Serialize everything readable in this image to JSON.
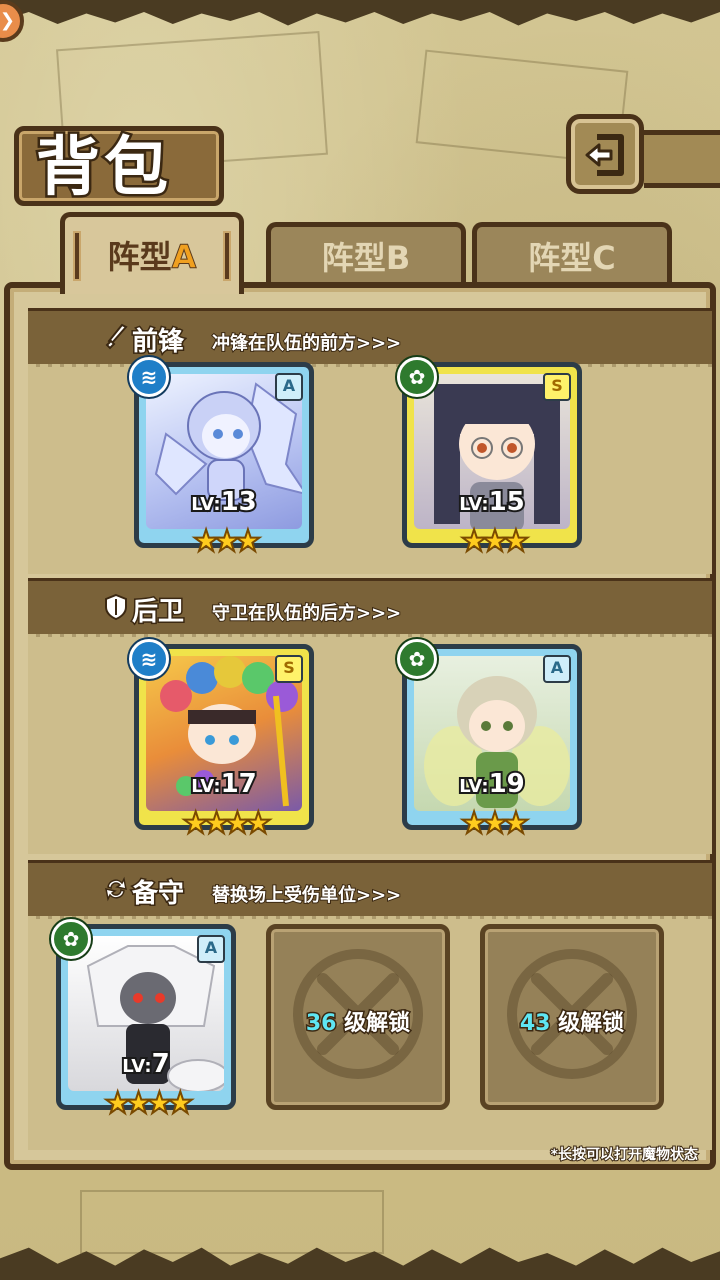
{
  "header": {
    "title": "背包"
  },
  "tabs": [
    {
      "label": "阵型",
      "suffix": "A",
      "active": true
    },
    {
      "label": "阵型",
      "suffix": "B",
      "active": false
    },
    {
      "label": "阵型",
      "suffix": "C",
      "active": false
    }
  ],
  "sections": {
    "front": {
      "title": "前锋",
      "desc": "冲锋在队伍的前方>>>"
    },
    "back": {
      "title": "后卫",
      "desc": "守卫在队伍的后方>>>"
    },
    "reserve": {
      "title": "备守",
      "desc": "替换场上受伤单位>>>"
    }
  },
  "units": [
    {
      "rank": "A",
      "element": "water",
      "level": "13",
      "lv_prefix": "LV:",
      "stars": "★★★"
    },
    {
      "rank": "S",
      "element": "grass",
      "level": "15",
      "lv_prefix": "LV:",
      "stars": "★★★"
    },
    {
      "rank": "S",
      "element": "water",
      "level": "17",
      "lv_prefix": "LV:",
      "stars": "★★★★"
    },
    {
      "rank": "A",
      "element": "grass",
      "level": "19",
      "lv_prefix": "LV:",
      "stars": "★★★"
    },
    {
      "rank": "A",
      "element": "grass",
      "level": "7",
      "lv_prefix": "LV:",
      "stars": "★★★★"
    }
  ],
  "locked_slots": [
    {
      "level": "36",
      "text": "级解锁"
    },
    {
      "level": "43",
      "text": "级解锁"
    }
  ],
  "hint": "*长按可以打开魔物状态",
  "colors": {
    "rank_a_frame": "#8fd4ef",
    "rank_s_frame": "#f0e34a",
    "water": "#1f7fc8",
    "grass": "#2e7a2e",
    "unlock_level": "#5fe6f3"
  }
}
